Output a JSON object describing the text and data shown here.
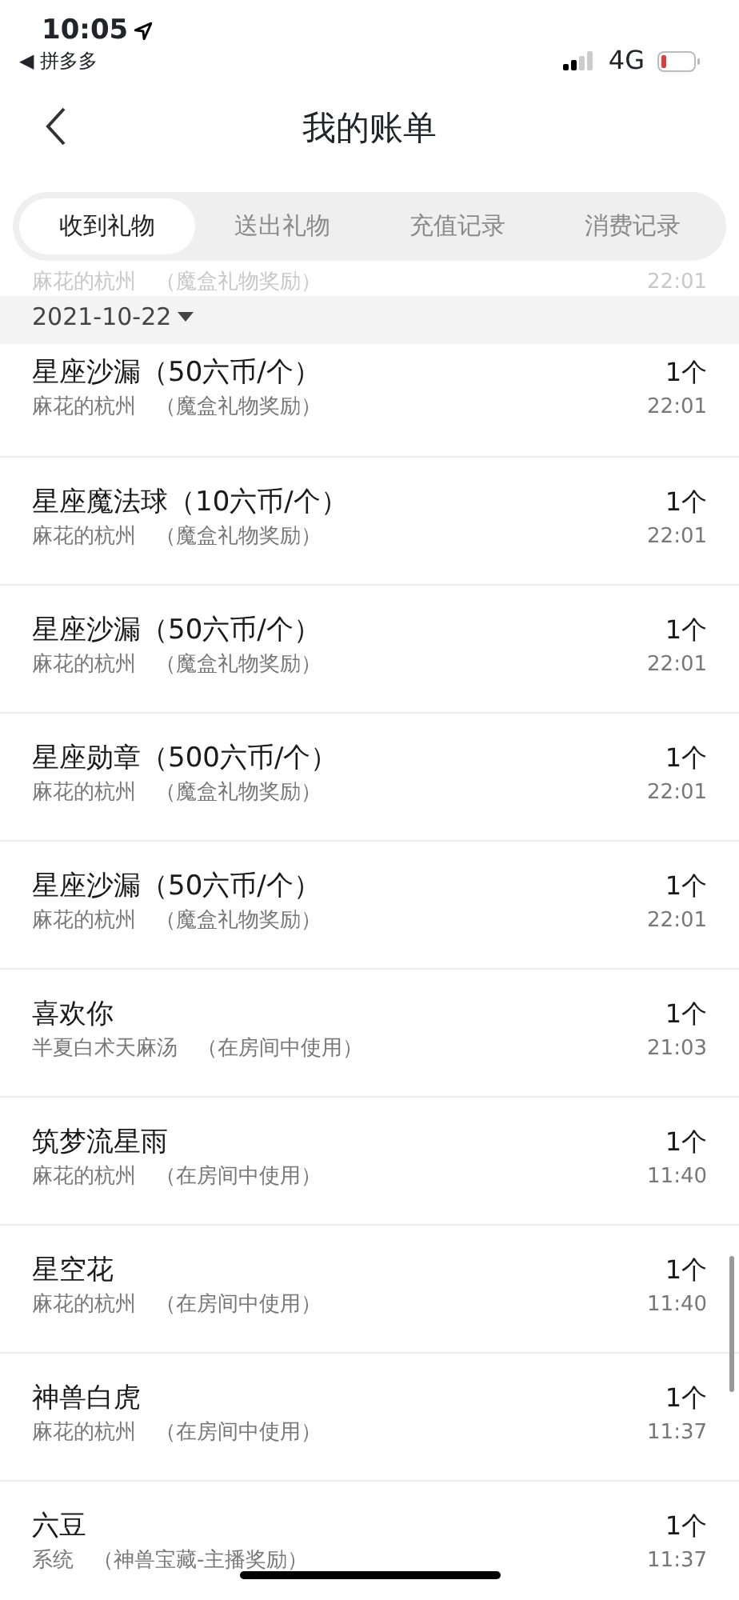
{
  "status_bar": {
    "time": "10:05",
    "back_app_arrow": "◀",
    "back_app": "拼多多",
    "network": "4G"
  },
  "nav": {
    "title": "我的账单"
  },
  "tabs": [
    {
      "label": "收到礼物",
      "selected": true
    },
    {
      "label": "送出礼物",
      "selected": false
    },
    {
      "label": "充值记录",
      "selected": false
    },
    {
      "label": "消费记录",
      "selected": false
    }
  ],
  "partial_row": {
    "sender": "麻花的杭州",
    "note": "（魔盒礼物奖励）",
    "time": "22:01"
  },
  "date_header": {
    "date": "2021-10-22"
  },
  "rows": [
    {
      "title": "星座沙漏（50六币/个）",
      "sender": "麻花的杭州",
      "note": "（魔盒礼物奖励）",
      "quantity": "1个",
      "time": "22:01"
    },
    {
      "title": "星座魔法球（10六币/个）",
      "sender": "麻花的杭州",
      "note": "（魔盒礼物奖励）",
      "quantity": "1个",
      "time": "22:01"
    },
    {
      "title": "星座沙漏（50六币/个）",
      "sender": "麻花的杭州",
      "note": "（魔盒礼物奖励）",
      "quantity": "1个",
      "time": "22:01"
    },
    {
      "title": "星座勋章（500六币/个）",
      "sender": "麻花的杭州",
      "note": "（魔盒礼物奖励）",
      "quantity": "1个",
      "time": "22:01"
    },
    {
      "title": "星座沙漏（50六币/个）",
      "sender": "麻花的杭州",
      "note": "（魔盒礼物奖励）",
      "quantity": "1个",
      "time": "22:01"
    },
    {
      "title": "喜欢你",
      "sender": "半夏白术天麻汤",
      "note": "（在房间中使用）",
      "quantity": "1个",
      "time": "21:03"
    },
    {
      "title": "筑梦流星雨",
      "sender": "麻花的杭州",
      "note": "（在房间中使用）",
      "quantity": "1个",
      "time": "11:40"
    },
    {
      "title": "星空花",
      "sender": "麻花的杭州",
      "note": "（在房间中使用）",
      "quantity": "1个",
      "time": "11:40"
    },
    {
      "title": "神兽白虎",
      "sender": "麻花的杭州",
      "note": "（在房间中使用）",
      "quantity": "1个",
      "time": "11:37"
    },
    {
      "title": "六豆",
      "sender": "系统",
      "note": "（神兽宝藏-主播奖励）",
      "quantity": "1个",
      "time": "11:37"
    }
  ]
}
